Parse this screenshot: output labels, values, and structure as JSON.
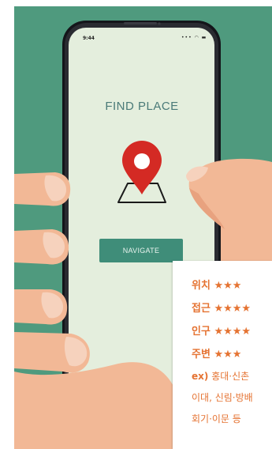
{
  "phone": {
    "status_time": "9:44",
    "status_icons": "••• ◠ ▬",
    "title": "FIND PLACE",
    "navigate_label": "NAVIGATE"
  },
  "card": {
    "ratings": [
      {
        "label": "위치",
        "stars": "★★★"
      },
      {
        "label": "접근",
        "stars": "★★★★"
      },
      {
        "label": "인구",
        "stars": "★★★★"
      },
      {
        "label": "주변",
        "stars": "★★★"
      }
    ],
    "example_prefix": "ex)",
    "example_lines": [
      "홍대·신촌",
      "이대, 신림·방배",
      "회기·이문 등"
    ]
  },
  "colors": {
    "background": "#4f9a7e",
    "screen": "#e4eedd",
    "pin": "#d42a24",
    "button": "#3f8d79",
    "accent": "#e57332"
  }
}
